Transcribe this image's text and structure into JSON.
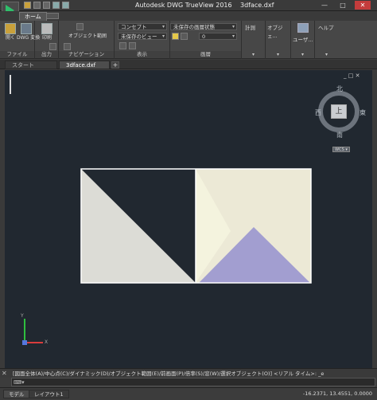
{
  "window": {
    "app_title": "Autodesk DWG TrueView 2016",
    "file_name": "3dface.dxf",
    "controls": [
      "—",
      "□",
      "✕"
    ]
  },
  "ribbon": {
    "tabs": [
      "ホーム"
    ],
    "groups": {
      "file": {
        "label": "ファイル",
        "buttons": [
          "開く",
          "DWG 変換"
        ]
      },
      "output": {
        "label": "出力",
        "buttons": [
          "印刷"
        ]
      },
      "navigation": {
        "label": "ナビゲーション",
        "buttons": [
          "オブジェクト範囲"
        ]
      },
      "view": {
        "label": "表示",
        "visual_style": "コンセプト",
        "named_view": "未保存のビュー",
        "layer_state": "未保存の画層状態",
        "layer": "0"
      },
      "layers": {
        "label": "画層"
      },
      "measure": {
        "label": "計測"
      },
      "object": {
        "label": "オブジェ..."
      },
      "user": {
        "label": "ユーザ..."
      },
      "help": {
        "label": "ヘルプ"
      }
    }
  },
  "document_tabs": [
    {
      "label": "スタート",
      "active": false
    },
    {
      "label": "3dface.dxf",
      "active": true
    }
  ],
  "viewport": {
    "controls": "_ □ ✕",
    "viewcube": {
      "face": "上",
      "north": "北",
      "south": "南",
      "east": "東",
      "west": "西",
      "wcs": "WCS ▾"
    },
    "ucs": {
      "x": "X",
      "y": "Y"
    },
    "drawing": {
      "background": "#212830",
      "left_triangle_color": "#dcdcd6",
      "right_face_color": "#ece9d6",
      "right_inner_triangle_color": "#f4f3de",
      "bottom_triangle_color": "#a29ed0",
      "outline_color": "#ffffff"
    }
  },
  "command": {
    "history": "[図面全体(A)/中心点(C)/ダイナミック(D)/オブジェクト範囲(E)/前画面(P)/倍率(S)/窓(W)/選択オブジェクト(O)] <リアル タイム>: _e",
    "input_placeholder": ""
  },
  "status": {
    "tabs": [
      "モデル",
      "レイアウト1"
    ],
    "coordinates": "-16.2371, 13.4551, 0.0000"
  }
}
